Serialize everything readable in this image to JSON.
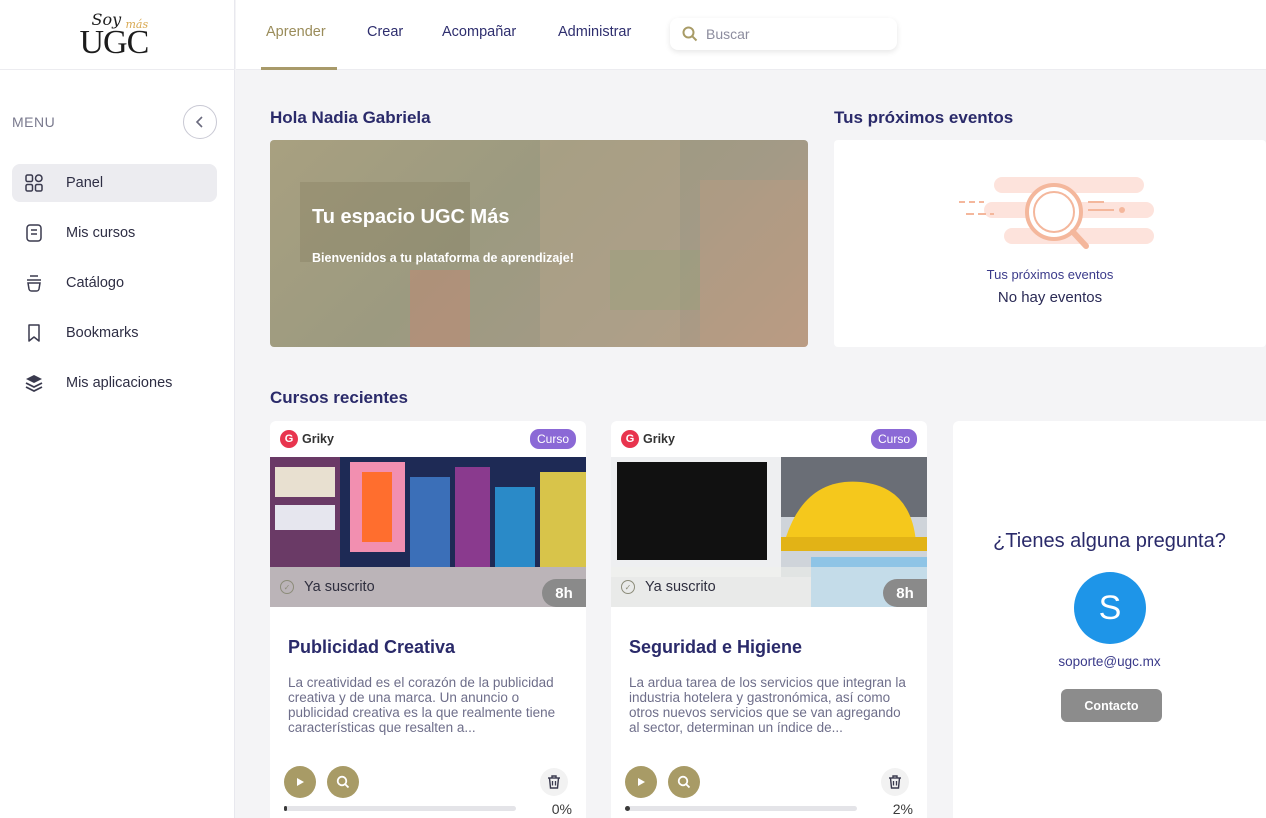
{
  "brand": {
    "logo_text": "UGC",
    "logo_soy": "Soy",
    "logo_mas": "más"
  },
  "sidebar": {
    "menu_label": "MENU",
    "items": [
      {
        "label": "Panel",
        "icon": "grid-icon",
        "active": true
      },
      {
        "label": "Mis cursos",
        "icon": "book-icon",
        "active": false
      },
      {
        "label": "Catálogo",
        "icon": "catalog-icon",
        "active": false
      },
      {
        "label": "Bookmarks",
        "icon": "bookmark-icon",
        "active": false
      },
      {
        "label": "Mis aplicaciones",
        "icon": "layers-icon",
        "active": false
      }
    ]
  },
  "topbar": {
    "tabs": [
      {
        "label": "Aprender",
        "active": true
      },
      {
        "label": "Crear",
        "active": false
      },
      {
        "label": "Acompañar",
        "active": false
      },
      {
        "label": "Administrar",
        "active": false
      }
    ],
    "search_placeholder": "Buscar"
  },
  "greeting": "Hola Nadia Gabriela",
  "hero": {
    "title": "Tu espacio UGC Más",
    "subtitle": "Bienvenidos a tu plataforma de aprendizaje!"
  },
  "events": {
    "title": "Tus próximos eventos",
    "label": "Tus próximos eventos",
    "empty": "No hay eventos"
  },
  "recent": {
    "title": "Cursos recientes",
    "courses": [
      {
        "provider": "Griky",
        "badge": "Curso",
        "status": "Ya suscrito",
        "hours": "8h",
        "title": "Publicidad Creativa",
        "description": "La creatividad es el corazón de la publicidad creativa y de una marca. Un anuncio o publicidad creativa es la que realmente tiene características que resalten a...",
        "progress_pct": 0,
        "progress_label": "0%"
      },
      {
        "provider": "Griky",
        "badge": "Curso",
        "status": "Ya suscrito",
        "hours": "8h",
        "title": "Seguridad e Higiene",
        "description": "La ardua tarea de los servicios que integran la industria hotelera y gastronómica, así como otros nuevos servicios que se van agregando al sector, determinan un índice de...",
        "progress_pct": 2,
        "progress_label": "2%"
      }
    ]
  },
  "help": {
    "title": "¿Tienes alguna pregunta?",
    "avatar_letter": "S",
    "email": "soporte@ugc.mx",
    "button": "Contacto"
  },
  "colors": {
    "accent_gold": "#a89b66",
    "navy_text": "#2a2a6a",
    "badge_purple": "#8b69d6",
    "avatar_blue": "#1e95e8",
    "griky_red": "#e8344e"
  }
}
